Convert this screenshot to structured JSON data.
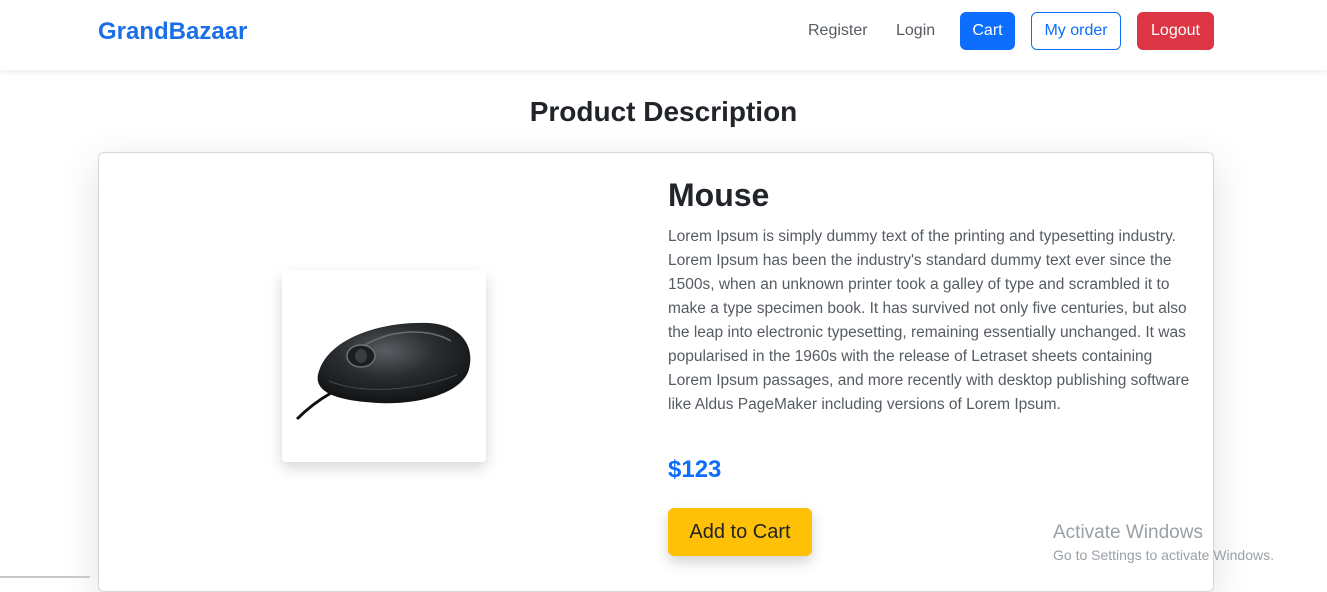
{
  "navbar": {
    "brand": "GrandBazaar",
    "register_label": "Register",
    "login_label": "Login",
    "cart_label": "Cart",
    "my_order_label": "My order",
    "logout_label": "Logout"
  },
  "page": {
    "title": "Product Description"
  },
  "product": {
    "name": "Mouse",
    "description": "Lorem Ipsum is simply dummy text of the printing and typesetting industry. Lorem Ipsum has been the industry's standard dummy text ever since the 1500s, when an unknown printer took a galley of type and scrambled it to make a type specimen book. It has survived not only five centuries, but also the leap into electronic typesetting, remaining essentially unchanged. It was popularised in the 1960s with the release of Letraset sheets containing Lorem Ipsum passages, and more recently with desktop publishing software like Aldus PageMaker including versions of Lorem Ipsum.",
    "price": "$123",
    "add_to_cart_label": "Add to Cart",
    "image_icon": "computer-mouse"
  },
  "watermark": {
    "line1": "Activate Windows",
    "line2": "Go to Settings to activate Windows."
  },
  "colors": {
    "brand": "#1a6fe8",
    "primary": "#0d6efd",
    "danger": "#dc3545",
    "warning": "#ffc107"
  }
}
